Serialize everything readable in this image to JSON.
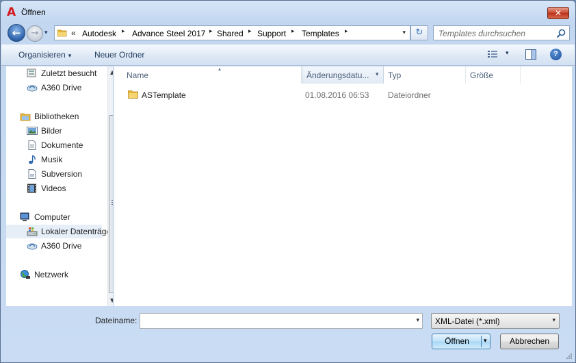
{
  "window": {
    "title": "Öffnen",
    "close_glyph": "✕",
    "app_icon_glyph": "A"
  },
  "nav": {
    "back_glyph": "←",
    "forward_glyph": "→",
    "history_glyph": "▾",
    "address": {
      "overflow_glyph": "«",
      "crumbs": [
        "Autodesk",
        "Advance Steel 2017",
        "Shared",
        "Support",
        "Templates"
      ],
      "separator_glyph": "▸",
      "dropdown_glyph": "▾"
    },
    "refresh_glyph": "↻",
    "search_placeholder": "Templates durchsuchen"
  },
  "toolbar": {
    "organize_label": "Organisieren",
    "organize_caret": "▾",
    "new_folder_label": "Neuer Ordner",
    "view_caret": "▾",
    "help_glyph": "?"
  },
  "sidebar": {
    "items": [
      {
        "label": "Zuletzt besucht",
        "icon": "recent-places-icon"
      },
      {
        "label": "A360 Drive",
        "icon": "cloud-drive-icon"
      },
      {
        "label": "Bibliotheken",
        "icon": "libraries-icon"
      },
      {
        "label": "Bilder",
        "icon": "pictures-icon"
      },
      {
        "label": "Dokumente",
        "icon": "documents-icon"
      },
      {
        "label": "Musik",
        "icon": "music-icon"
      },
      {
        "label": "Subversion",
        "icon": "subversion-icon"
      },
      {
        "label": "Videos",
        "icon": "videos-icon"
      },
      {
        "label": "Computer",
        "icon": "computer-icon"
      },
      {
        "label": "Lokaler Datenträger",
        "icon": "local-disk-icon"
      },
      {
        "label": "A360 Drive",
        "icon": "cloud-drive-icon"
      },
      {
        "label": "Netzwerk",
        "icon": "network-icon"
      }
    ],
    "selected_index": 9,
    "scroll_up_glyph": "▲",
    "scroll_down_glyph": "▼"
  },
  "file_list": {
    "columns": [
      "Name",
      "Änderungsdatu...",
      "Typ",
      "Größe"
    ],
    "sort_glyph": "▴",
    "column_dropdown_glyph": "▾",
    "rows": [
      {
        "name": "ASTemplate",
        "modified": "01.08.2016 06:53",
        "type": "Dateiordner",
        "size": ""
      }
    ]
  },
  "footer": {
    "filename_label": "Dateiname:",
    "filename_value": "",
    "filename_dropdown_glyph": "▾",
    "filter_value": "XML-Datei (*.xml)",
    "filter_dropdown_glyph": "▾",
    "open_label": "Öffnen",
    "open_dropdown_glyph": "▾",
    "cancel_label": "Abbrechen"
  },
  "colors": {
    "accent_blue": "#2b5fa8",
    "folder_yellow": "#e8b73a",
    "close_red": "#c7442b",
    "app_icon_red": "#d4181e"
  }
}
